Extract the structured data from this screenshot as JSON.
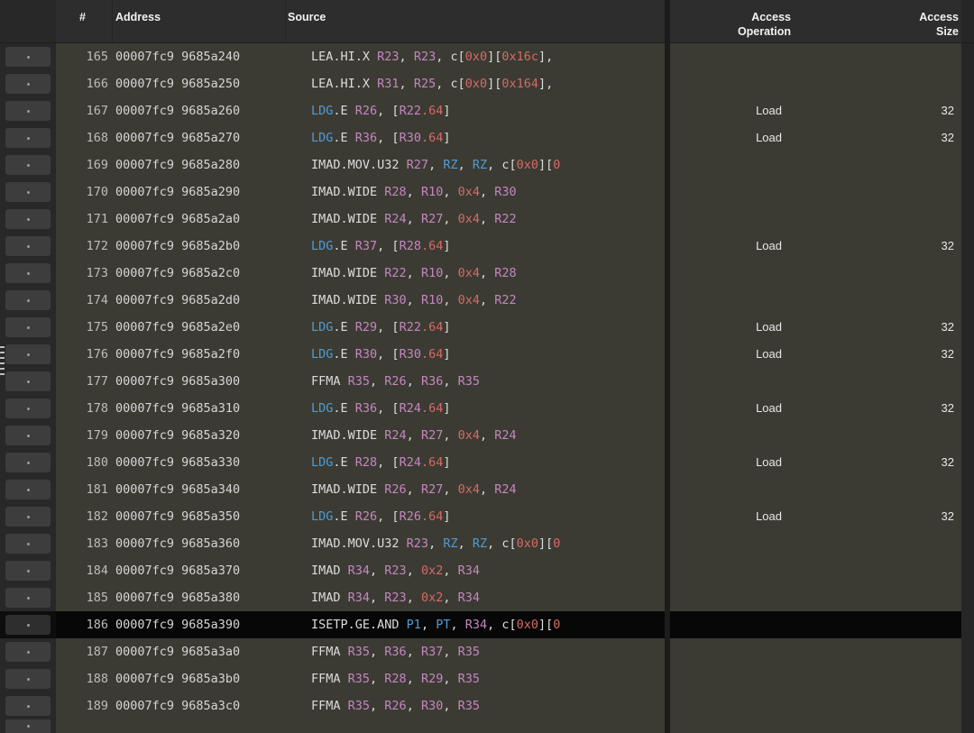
{
  "header": {
    "num": "#",
    "address": "Address",
    "source": "Source",
    "access_operation": [
      "Access",
      "Operation"
    ],
    "access_size": [
      "Access",
      "Size"
    ]
  },
  "colors": {
    "row-bg": "#3b3b33",
    "row-selected-bg": "#070707",
    "header-bg": "#2d2d2d",
    "gutter-bg": "#282828",
    "token-plain": "#dcdcdc",
    "token-register": "#c586c0",
    "token-literal": "#d66a66",
    "token-keyword": "#4f9cd6"
  },
  "rows": [
    {
      "num": "165",
      "address": "00007fc9 9685a240",
      "src": [
        [
          "LEA.HI.X ",
          "w"
        ],
        [
          "R23",
          "p"
        ],
        [
          ", ",
          "w"
        ],
        [
          "R23",
          "p"
        ],
        [
          ", c[",
          "w"
        ],
        [
          "0x0",
          "r"
        ],
        [
          "][",
          "w"
        ],
        [
          "0x16c",
          "r"
        ],
        [
          "],",
          "w"
        ]
      ],
      "op": "",
      "size": "",
      "selected": false
    },
    {
      "num": "166",
      "address": "00007fc9 9685a250",
      "src": [
        [
          "LEA.HI.X ",
          "w"
        ],
        [
          "R31",
          "p"
        ],
        [
          ", ",
          "w"
        ],
        [
          "R25",
          "p"
        ],
        [
          ", c[",
          "w"
        ],
        [
          "0x0",
          "r"
        ],
        [
          "][",
          "w"
        ],
        [
          "0x164",
          "r"
        ],
        [
          "],",
          "w"
        ]
      ],
      "op": "",
      "size": "",
      "selected": false
    },
    {
      "num": "167",
      "address": "00007fc9 9685a260",
      "src": [
        [
          "LDG",
          "b"
        ],
        [
          ".E ",
          "w"
        ],
        [
          "R26",
          "p"
        ],
        [
          ", [",
          "w"
        ],
        [
          "R22",
          "p"
        ],
        [
          ".64",
          "r"
        ],
        [
          "]",
          "w"
        ]
      ],
      "op": "Load",
      "size": "32",
      "selected": false
    },
    {
      "num": "168",
      "address": "00007fc9 9685a270",
      "src": [
        [
          "LDG",
          "b"
        ],
        [
          ".E ",
          "w"
        ],
        [
          "R36",
          "p"
        ],
        [
          ", [",
          "w"
        ],
        [
          "R30",
          "p"
        ],
        [
          ".64",
          "r"
        ],
        [
          "]",
          "w"
        ]
      ],
      "op": "Load",
      "size": "32",
      "selected": false
    },
    {
      "num": "169",
      "address": "00007fc9 9685a280",
      "src": [
        [
          "IMAD.MOV.U32 ",
          "w"
        ],
        [
          "R27",
          "p"
        ],
        [
          ", ",
          "w"
        ],
        [
          "RZ",
          "b"
        ],
        [
          ", ",
          "w"
        ],
        [
          "RZ",
          "b"
        ],
        [
          ", c[",
          "w"
        ],
        [
          "0x0",
          "r"
        ],
        [
          "][",
          "w"
        ],
        [
          "0",
          "r"
        ]
      ],
      "op": "",
      "size": "",
      "selected": false
    },
    {
      "num": "170",
      "address": "00007fc9 9685a290",
      "src": [
        [
          "IMAD.WIDE ",
          "w"
        ],
        [
          "R28",
          "p"
        ],
        [
          ", ",
          "w"
        ],
        [
          "R10",
          "p"
        ],
        [
          ", ",
          "w"
        ],
        [
          "0x4",
          "r"
        ],
        [
          ", ",
          "w"
        ],
        [
          "R30",
          "p"
        ]
      ],
      "op": "",
      "size": "",
      "selected": false
    },
    {
      "num": "171",
      "address": "00007fc9 9685a2a0",
      "src": [
        [
          "IMAD.WIDE ",
          "w"
        ],
        [
          "R24",
          "p"
        ],
        [
          ", ",
          "w"
        ],
        [
          "R27",
          "p"
        ],
        [
          ", ",
          "w"
        ],
        [
          "0x4",
          "r"
        ],
        [
          ", ",
          "w"
        ],
        [
          "R22",
          "p"
        ]
      ],
      "op": "",
      "size": "",
      "selected": false
    },
    {
      "num": "172",
      "address": "00007fc9 9685a2b0",
      "src": [
        [
          "LDG",
          "b"
        ],
        [
          ".E ",
          "w"
        ],
        [
          "R37",
          "p"
        ],
        [
          ", [",
          "w"
        ],
        [
          "R28",
          "p"
        ],
        [
          ".64",
          "r"
        ],
        [
          "]",
          "w"
        ]
      ],
      "op": "Load",
      "size": "32",
      "selected": false
    },
    {
      "num": "173",
      "address": "00007fc9 9685a2c0",
      "src": [
        [
          "IMAD.WIDE ",
          "w"
        ],
        [
          "R22",
          "p"
        ],
        [
          ", ",
          "w"
        ],
        [
          "R10",
          "p"
        ],
        [
          ", ",
          "w"
        ],
        [
          "0x4",
          "r"
        ],
        [
          ", ",
          "w"
        ],
        [
          "R28",
          "p"
        ]
      ],
      "op": "",
      "size": "",
      "selected": false
    },
    {
      "num": "174",
      "address": "00007fc9 9685a2d0",
      "src": [
        [
          "IMAD.WIDE ",
          "w"
        ],
        [
          "R30",
          "p"
        ],
        [
          ", ",
          "w"
        ],
        [
          "R10",
          "p"
        ],
        [
          ", ",
          "w"
        ],
        [
          "0x4",
          "r"
        ],
        [
          ", ",
          "w"
        ],
        [
          "R22",
          "p"
        ]
      ],
      "op": "",
      "size": "",
      "selected": false
    },
    {
      "num": "175",
      "address": "00007fc9 9685a2e0",
      "src": [
        [
          "LDG",
          "b"
        ],
        [
          ".E ",
          "w"
        ],
        [
          "R29",
          "p"
        ],
        [
          ", [",
          "w"
        ],
        [
          "R22",
          "p"
        ],
        [
          ".64",
          "r"
        ],
        [
          "]",
          "w"
        ]
      ],
      "op": "Load",
      "size": "32",
      "selected": false
    },
    {
      "num": "176",
      "address": "00007fc9 9685a2f0",
      "src": [
        [
          "LDG",
          "b"
        ],
        [
          ".E ",
          "w"
        ],
        [
          "R30",
          "p"
        ],
        [
          ", [",
          "w"
        ],
        [
          "R30",
          "p"
        ],
        [
          ".64",
          "r"
        ],
        [
          "]",
          "w"
        ]
      ],
      "op": "Load",
      "size": "32",
      "selected": false
    },
    {
      "num": "177",
      "address": "00007fc9 9685a300",
      "src": [
        [
          "FFMA ",
          "w"
        ],
        [
          "R35",
          "p"
        ],
        [
          ", ",
          "w"
        ],
        [
          "R26",
          "p"
        ],
        [
          ", ",
          "w"
        ],
        [
          "R36",
          "p"
        ],
        [
          ", ",
          "w"
        ],
        [
          "R35",
          "p"
        ]
      ],
      "op": "",
      "size": "",
      "selected": false
    },
    {
      "num": "178",
      "address": "00007fc9 9685a310",
      "src": [
        [
          "LDG",
          "b"
        ],
        [
          ".E ",
          "w"
        ],
        [
          "R36",
          "p"
        ],
        [
          ", [",
          "w"
        ],
        [
          "R24",
          "p"
        ],
        [
          ".64",
          "r"
        ],
        [
          "]",
          "w"
        ]
      ],
      "op": "Load",
      "size": "32",
      "selected": false
    },
    {
      "num": "179",
      "address": "00007fc9 9685a320",
      "src": [
        [
          "IMAD.WIDE ",
          "w"
        ],
        [
          "R24",
          "p"
        ],
        [
          ", ",
          "w"
        ],
        [
          "R27",
          "p"
        ],
        [
          ", ",
          "w"
        ],
        [
          "0x4",
          "r"
        ],
        [
          ", ",
          "w"
        ],
        [
          "R24",
          "p"
        ]
      ],
      "op": "",
      "size": "",
      "selected": false
    },
    {
      "num": "180",
      "address": "00007fc9 9685a330",
      "src": [
        [
          "LDG",
          "b"
        ],
        [
          ".E ",
          "w"
        ],
        [
          "R28",
          "p"
        ],
        [
          ", [",
          "w"
        ],
        [
          "R24",
          "p"
        ],
        [
          ".64",
          "r"
        ],
        [
          "]",
          "w"
        ]
      ],
      "op": "Load",
      "size": "32",
      "selected": false
    },
    {
      "num": "181",
      "address": "00007fc9 9685a340",
      "src": [
        [
          "IMAD.WIDE ",
          "w"
        ],
        [
          "R26",
          "p"
        ],
        [
          ", ",
          "w"
        ],
        [
          "R27",
          "p"
        ],
        [
          ", ",
          "w"
        ],
        [
          "0x4",
          "r"
        ],
        [
          ", ",
          "w"
        ],
        [
          "R24",
          "p"
        ]
      ],
      "op": "",
      "size": "",
      "selected": false
    },
    {
      "num": "182",
      "address": "00007fc9 9685a350",
      "src": [
        [
          "LDG",
          "b"
        ],
        [
          ".E ",
          "w"
        ],
        [
          "R26",
          "p"
        ],
        [
          ", [",
          "w"
        ],
        [
          "R26",
          "p"
        ],
        [
          ".64",
          "r"
        ],
        [
          "]",
          "w"
        ]
      ],
      "op": "Load",
      "size": "32",
      "selected": false
    },
    {
      "num": "183",
      "address": "00007fc9 9685a360",
      "src": [
        [
          "IMAD.MOV.U32 ",
          "w"
        ],
        [
          "R23",
          "p"
        ],
        [
          ", ",
          "w"
        ],
        [
          "RZ",
          "b"
        ],
        [
          ", ",
          "w"
        ],
        [
          "RZ",
          "b"
        ],
        [
          ", c[",
          "w"
        ],
        [
          "0x0",
          "r"
        ],
        [
          "][",
          "w"
        ],
        [
          "0",
          "r"
        ]
      ],
      "op": "",
      "size": "",
      "selected": false
    },
    {
      "num": "184",
      "address": "00007fc9 9685a370",
      "src": [
        [
          "IMAD ",
          "w"
        ],
        [
          "R34",
          "p"
        ],
        [
          ", ",
          "w"
        ],
        [
          "R23",
          "p"
        ],
        [
          ", ",
          "w"
        ],
        [
          "0x2",
          "r"
        ],
        [
          ", ",
          "w"
        ],
        [
          "R34",
          "p"
        ]
      ],
      "op": "",
      "size": "",
      "selected": false
    },
    {
      "num": "185",
      "address": "00007fc9 9685a380",
      "src": [
        [
          "IMAD ",
          "w"
        ],
        [
          "R34",
          "p"
        ],
        [
          ", ",
          "w"
        ],
        [
          "R23",
          "p"
        ],
        [
          ", ",
          "w"
        ],
        [
          "0x2",
          "r"
        ],
        [
          ", ",
          "w"
        ],
        [
          "R34",
          "p"
        ]
      ],
      "op": "",
      "size": "",
      "selected": false
    },
    {
      "num": "186",
      "address": "00007fc9 9685a390",
      "src": [
        [
          "ISETP.GE.AND ",
          "w"
        ],
        [
          "P1",
          "b"
        ],
        [
          ", ",
          "w"
        ],
        [
          "PT",
          "b"
        ],
        [
          ", ",
          "w"
        ],
        [
          "R34",
          "p"
        ],
        [
          ", c[",
          "w"
        ],
        [
          "0x0",
          "r"
        ],
        [
          "][",
          "w"
        ],
        [
          "0",
          "r"
        ]
      ],
      "op": "",
      "size": "",
      "selected": true
    },
    {
      "num": "187",
      "address": "00007fc9 9685a3a0",
      "src": [
        [
          "FFMA ",
          "w"
        ],
        [
          "R35",
          "p"
        ],
        [
          ", ",
          "w"
        ],
        [
          "R36",
          "p"
        ],
        [
          ", ",
          "w"
        ],
        [
          "R37",
          "p"
        ],
        [
          ", ",
          "w"
        ],
        [
          "R35",
          "p"
        ]
      ],
      "op": "",
      "size": "",
      "selected": false
    },
    {
      "num": "188",
      "address": "00007fc9 9685a3b0",
      "src": [
        [
          "FFMA ",
          "w"
        ],
        [
          "R35",
          "p"
        ],
        [
          ", ",
          "w"
        ],
        [
          "R28",
          "p"
        ],
        [
          ", ",
          "w"
        ],
        [
          "R29",
          "p"
        ],
        [
          ", ",
          "w"
        ],
        [
          "R35",
          "p"
        ]
      ],
      "op": "",
      "size": "",
      "selected": false
    },
    {
      "num": "189",
      "address": "00007fc9 9685a3c0",
      "src": [
        [
          "FFMA ",
          "w"
        ],
        [
          "R35",
          "p"
        ],
        [
          ", ",
          "w"
        ],
        [
          "R26",
          "p"
        ],
        [
          ", ",
          "w"
        ],
        [
          "R30",
          "p"
        ],
        [
          ", ",
          "w"
        ],
        [
          "R35",
          "p"
        ]
      ],
      "op": "",
      "size": "",
      "selected": false
    }
  ]
}
